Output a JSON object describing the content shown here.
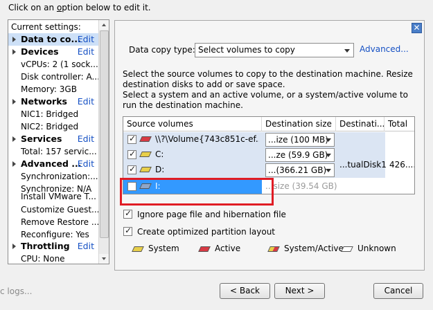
{
  "instruction": {
    "pre": "Click on an ",
    "under": "o",
    "post": "ption below to edit it."
  },
  "settings": {
    "title": "Current settings:",
    "edit_label": "Edit",
    "sections": [
      {
        "label": "Data to co...",
        "selected": true,
        "items": []
      },
      {
        "label": "Devices",
        "items": [
          "vCPUs: 2 (1 sock...",
          "Disk controller: A...",
          "Memory: 3GB"
        ]
      },
      {
        "label": "Networks",
        "items": [
          "NIC1: Bridged",
          "NIC2: Bridged"
        ]
      },
      {
        "label": "Services",
        "items": [
          "Total: 157 servic..."
        ]
      },
      {
        "label": "Advanced ...",
        "items": [
          "Synchronization:...",
          "Synchronize: N/A",
          "Install VMware T...",
          "Customize Guest...",
          "Remove Restore ...",
          "Reconfigure: Yes"
        ]
      },
      {
        "label": "Throttling",
        "items": [
          "CPU: None"
        ]
      }
    ]
  },
  "content": {
    "data_copy_label": "Data copy type:",
    "data_copy_value": "Select volumes to copy",
    "advanced_link": "Advanced...",
    "desc1": "Select the source volumes to copy to the destination machine. Resize destination disks to add or save space.",
    "desc2": "Select a system and an active volume, or a system/active volume to run the destination machine.",
    "table": {
      "headers": [
        "Source volumes",
        "Destination size",
        "Destinati...",
        "Total"
      ],
      "rows": [
        {
          "checked": true,
          "type": "active",
          "name": "\\\\?\\Volume{743c851c-ef...",
          "dest_size": "...ize (100 MB)"
        },
        {
          "checked": true,
          "type": "system",
          "name": "C:",
          "dest_size": "...ze (59.9 GB)"
        },
        {
          "checked": true,
          "type": "system",
          "name": "D:",
          "dest_size": "...(366.21 GB)"
        },
        {
          "checked": false,
          "type": "unknown",
          "name": "I:",
          "dest_size": "...size (39.54 GB)"
        }
      ],
      "dest_disk": "...tualDisk1",
      "total": "426...."
    },
    "ignore_page_file": "Ignore page file and hibernation file",
    "create_optimized": "Create optimized partition layout",
    "legend": {
      "system": "System",
      "active": "Active",
      "system_active": "System/Active",
      "unknown": "Unknown"
    }
  },
  "footer": {
    "logs_label": "c logs...",
    "back": "< Back",
    "next": "Next >",
    "cancel": "Cancel"
  }
}
